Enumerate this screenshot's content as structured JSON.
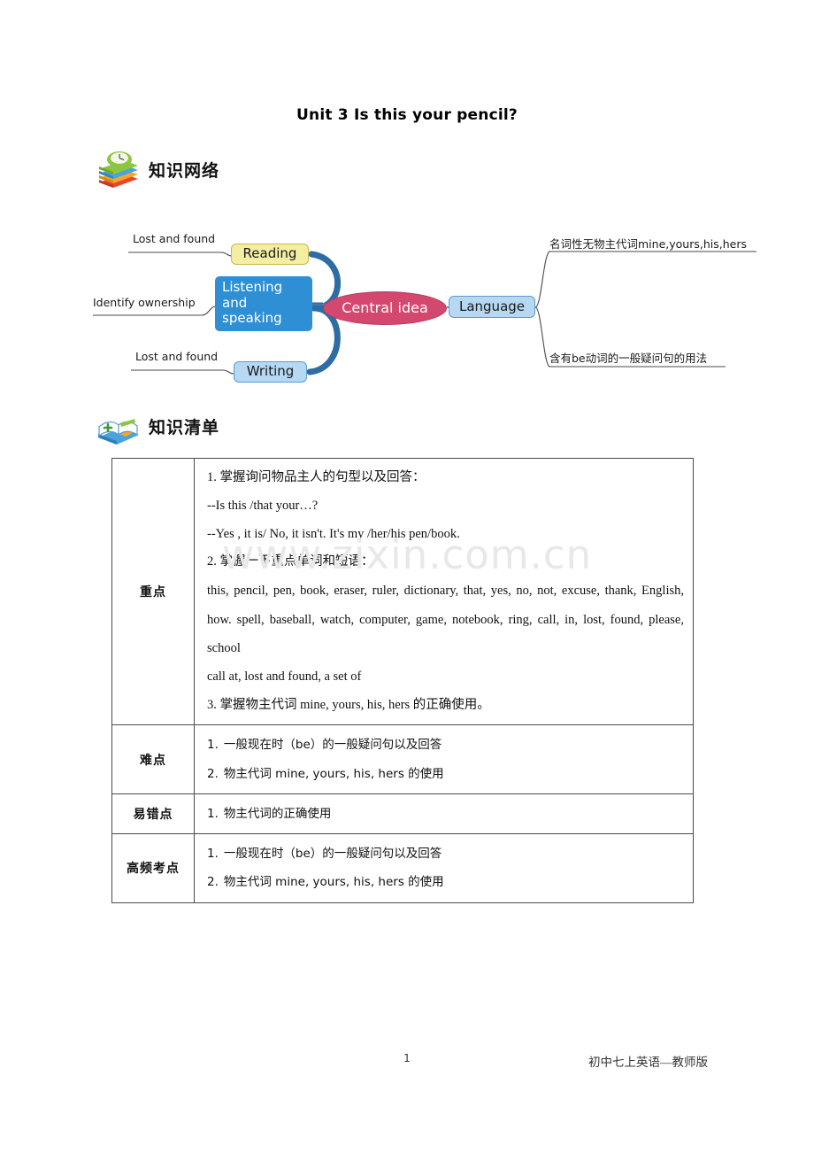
{
  "document": {
    "title": "Unit 3 Is this your pencil?"
  },
  "sections": [
    {
      "icon": "book-stack-clock-icon",
      "heading": "知识网络"
    },
    {
      "icon": "book-stack-open-icon",
      "heading": "知识清单"
    }
  ],
  "mindmap": {
    "center": "Central idea",
    "branches": {
      "reading": "Reading",
      "listening": "Listening\nand\nspeaking",
      "listening_line1": "Listening",
      "listening_line2": "and",
      "listening_line3": "speaking",
      "writing": "Writing",
      "language": "Language"
    },
    "leaves": {
      "reading_leaf": "Lost and found",
      "listening_leaf": "Identify ownership",
      "writing_leaf": "Lost and found",
      "language_leaf_top": "名词性无物主代词mine,yours,his,hers",
      "language_leaf_bottom": "含有be动词的一般疑问句的用法"
    },
    "colors": {
      "reading_fill": "#f3eea2",
      "reading_border": "#c9b84a",
      "listening_fill": "#2f8fd4",
      "writing_fill": "#b6d8f2",
      "writing_border": "#5b9bd5",
      "center_fill": "#d44870",
      "connector": "#2e6da4"
    }
  },
  "table": {
    "rows": [
      {
        "label": "重点",
        "lines": [
          "1. 掌握询问物品主人的句型以及回答：",
          "--Is this /that your…?",
          "--Yes , it is/ No, it isn't. It's my /her/his pen/book.",
          "2. 掌握一下重点单词和短语：",
          "this, pencil, pen, book, eraser, ruler, dictionary, that, yes, no, not, excuse, thank, English, how. spell, baseball, watch, computer, game, notebook, ring, call, in, lost, found, please, school",
          "call at, lost and found, a set of",
          "3.  掌握物主代词 mine, yours, his, hers 的正确使用。"
        ]
      },
      {
        "label": "难点",
        "items": [
          {
            "num": "1.",
            "text": "一般现在时（be）的一般疑问句以及回答"
          },
          {
            "num": "2.",
            "text": "物主代词 mine, yours, his, hers 的使用"
          }
        ]
      },
      {
        "label": "易错点",
        "items": [
          {
            "num": "1.",
            "text": "物主代词的正确使用"
          }
        ]
      },
      {
        "label": "高频考点",
        "items": [
          {
            "num": "1.",
            "text": "一般现在时（be）的一般疑问句以及回答"
          },
          {
            "num": "2.",
            "text": "物主代词 mine, yours, his, hers 的使用"
          }
        ]
      }
    ]
  },
  "watermark": {
    "text": "www.zixin.com.cn"
  },
  "footer": {
    "page_number": "1",
    "source": "初中七上英语—教师版"
  }
}
